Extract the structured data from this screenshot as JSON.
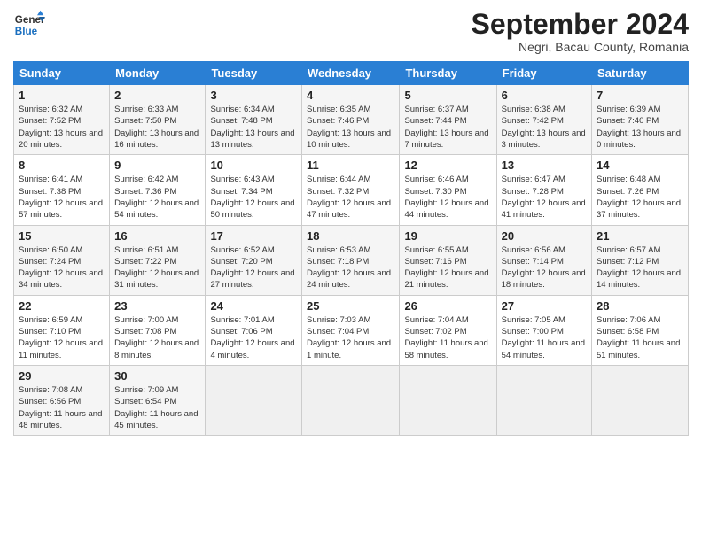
{
  "header": {
    "logo_line1": "General",
    "logo_line2": "Blue",
    "month_title": "September 2024",
    "subtitle": "Negri, Bacau County, Romania"
  },
  "days_of_week": [
    "Sunday",
    "Monday",
    "Tuesday",
    "Wednesday",
    "Thursday",
    "Friday",
    "Saturday"
  ],
  "weeks": [
    [
      {
        "day": "1",
        "sunrise": "6:32 AM",
        "sunset": "7:52 PM",
        "daylight": "13 hours and 20 minutes."
      },
      {
        "day": "2",
        "sunrise": "6:33 AM",
        "sunset": "7:50 PM",
        "daylight": "13 hours and 16 minutes."
      },
      {
        "day": "3",
        "sunrise": "6:34 AM",
        "sunset": "7:48 PM",
        "daylight": "13 hours and 13 minutes."
      },
      {
        "day": "4",
        "sunrise": "6:35 AM",
        "sunset": "7:46 PM",
        "daylight": "13 hours and 10 minutes."
      },
      {
        "day": "5",
        "sunrise": "6:37 AM",
        "sunset": "7:44 PM",
        "daylight": "13 hours and 7 minutes."
      },
      {
        "day": "6",
        "sunrise": "6:38 AM",
        "sunset": "7:42 PM",
        "daylight": "13 hours and 3 minutes."
      },
      {
        "day": "7",
        "sunrise": "6:39 AM",
        "sunset": "7:40 PM",
        "daylight": "13 hours and 0 minutes."
      }
    ],
    [
      {
        "day": "8",
        "sunrise": "6:41 AM",
        "sunset": "7:38 PM",
        "daylight": "12 hours and 57 minutes."
      },
      {
        "day": "9",
        "sunrise": "6:42 AM",
        "sunset": "7:36 PM",
        "daylight": "12 hours and 54 minutes."
      },
      {
        "day": "10",
        "sunrise": "6:43 AM",
        "sunset": "7:34 PM",
        "daylight": "12 hours and 50 minutes."
      },
      {
        "day": "11",
        "sunrise": "6:44 AM",
        "sunset": "7:32 PM",
        "daylight": "12 hours and 47 minutes."
      },
      {
        "day": "12",
        "sunrise": "6:46 AM",
        "sunset": "7:30 PM",
        "daylight": "12 hours and 44 minutes."
      },
      {
        "day": "13",
        "sunrise": "6:47 AM",
        "sunset": "7:28 PM",
        "daylight": "12 hours and 41 minutes."
      },
      {
        "day": "14",
        "sunrise": "6:48 AM",
        "sunset": "7:26 PM",
        "daylight": "12 hours and 37 minutes."
      }
    ],
    [
      {
        "day": "15",
        "sunrise": "6:50 AM",
        "sunset": "7:24 PM",
        "daylight": "12 hours and 34 minutes."
      },
      {
        "day": "16",
        "sunrise": "6:51 AM",
        "sunset": "7:22 PM",
        "daylight": "12 hours and 31 minutes."
      },
      {
        "day": "17",
        "sunrise": "6:52 AM",
        "sunset": "7:20 PM",
        "daylight": "12 hours and 27 minutes."
      },
      {
        "day": "18",
        "sunrise": "6:53 AM",
        "sunset": "7:18 PM",
        "daylight": "12 hours and 24 minutes."
      },
      {
        "day": "19",
        "sunrise": "6:55 AM",
        "sunset": "7:16 PM",
        "daylight": "12 hours and 21 minutes."
      },
      {
        "day": "20",
        "sunrise": "6:56 AM",
        "sunset": "7:14 PM",
        "daylight": "12 hours and 18 minutes."
      },
      {
        "day": "21",
        "sunrise": "6:57 AM",
        "sunset": "7:12 PM",
        "daylight": "12 hours and 14 minutes."
      }
    ],
    [
      {
        "day": "22",
        "sunrise": "6:59 AM",
        "sunset": "7:10 PM",
        "daylight": "12 hours and 11 minutes."
      },
      {
        "day": "23",
        "sunrise": "7:00 AM",
        "sunset": "7:08 PM",
        "daylight": "12 hours and 8 minutes."
      },
      {
        "day": "24",
        "sunrise": "7:01 AM",
        "sunset": "7:06 PM",
        "daylight": "12 hours and 4 minutes."
      },
      {
        "day": "25",
        "sunrise": "7:03 AM",
        "sunset": "7:04 PM",
        "daylight": "12 hours and 1 minute."
      },
      {
        "day": "26",
        "sunrise": "7:04 AM",
        "sunset": "7:02 PM",
        "daylight": "11 hours and 58 minutes."
      },
      {
        "day": "27",
        "sunrise": "7:05 AM",
        "sunset": "7:00 PM",
        "daylight": "11 hours and 54 minutes."
      },
      {
        "day": "28",
        "sunrise": "7:06 AM",
        "sunset": "6:58 PM",
        "daylight": "11 hours and 51 minutes."
      }
    ],
    [
      {
        "day": "29",
        "sunrise": "7:08 AM",
        "sunset": "6:56 PM",
        "daylight": "11 hours and 48 minutes."
      },
      {
        "day": "30",
        "sunrise": "7:09 AM",
        "sunset": "6:54 PM",
        "daylight": "11 hours and 45 minutes."
      },
      null,
      null,
      null,
      null,
      null
    ]
  ],
  "labels": {
    "sunrise": "Sunrise:",
    "sunset": "Sunset:",
    "daylight": "Daylight:"
  }
}
